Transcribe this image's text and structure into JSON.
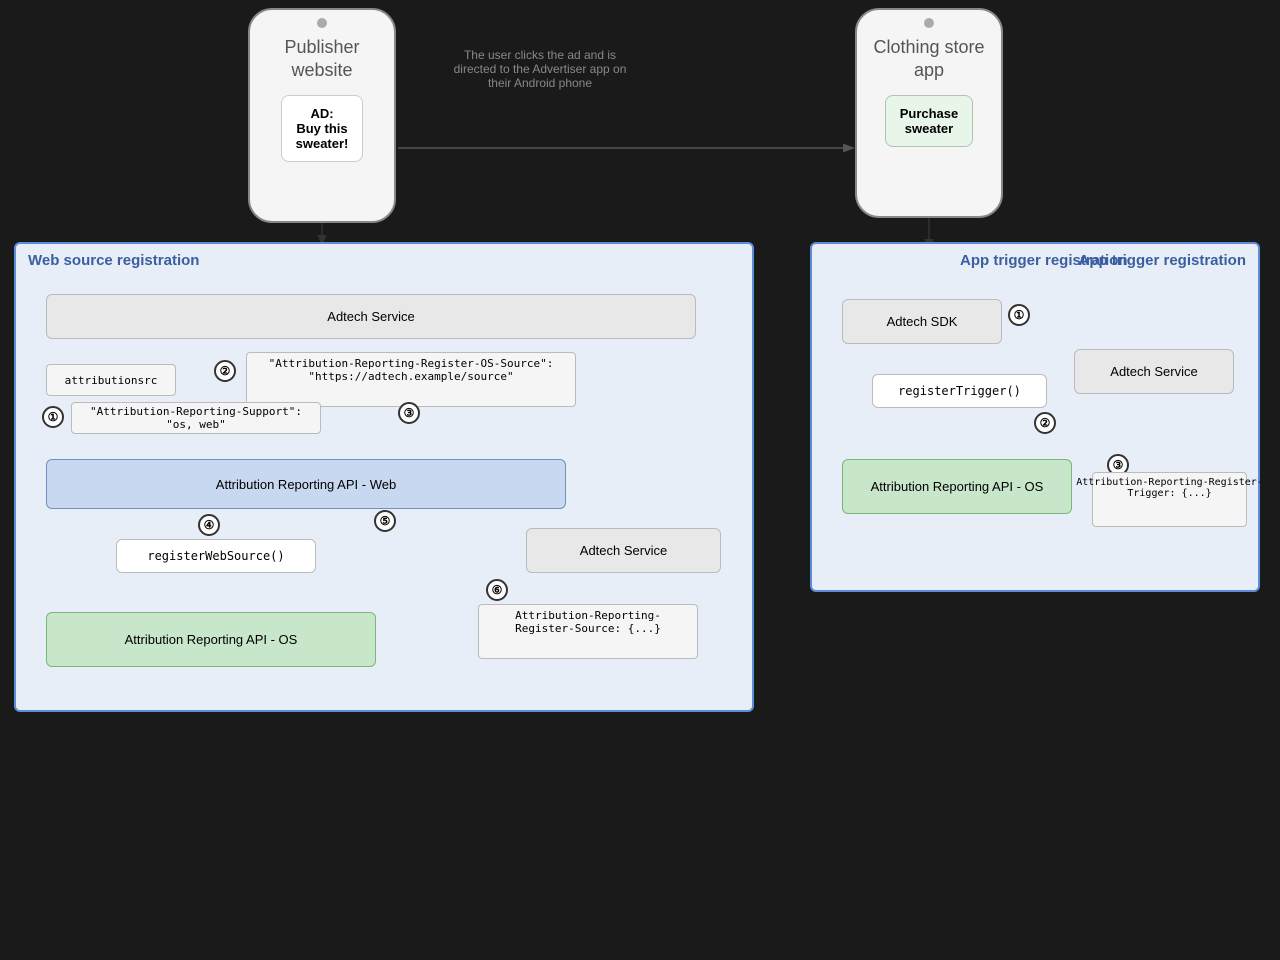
{
  "publisher": {
    "title": "Publisher\nwebsite",
    "ad_label": "AD:\nBuy this\nsweater!"
  },
  "clothing": {
    "title": "Clothing store\napp",
    "button": "Purchase\nsweater"
  },
  "arrow_label": "The user clicks the ad and is\ndirected to the Advertiser app on\ntheir Android phone",
  "web_section": {
    "title": "Web source registration",
    "adtech_service_top": "Adtech Service",
    "attributionsrc": "attributionsrc",
    "header_response": "\"Attribution-Reporting-Register-OS-Source\":\n\"https://adtech.example/source\"",
    "support_header": "\"Attribution-Reporting-Support\": \"os, web\"",
    "api_web": "Attribution Reporting API - Web",
    "register_web": "registerWebSource()",
    "adtech_service_bottom": "Adtech Service",
    "register_source_header": "Attribution-Reporting-\nRegister-Source: {...}",
    "api_os": "Attribution Reporting API - OS",
    "steps": [
      "①",
      "②",
      "③",
      "④",
      "⑤",
      "⑥"
    ]
  },
  "app_section": {
    "title": "App trigger registration",
    "adtech_sdk": "Adtech SDK",
    "register_trigger": "registerTrigger()",
    "adtech_service": "Adtech Service",
    "api_os": "Attribution Reporting API - OS",
    "trigger_header": "Attribution-Reporting-Register-\nTrigger: {...}",
    "steps": [
      "①",
      "②",
      "③"
    ]
  }
}
